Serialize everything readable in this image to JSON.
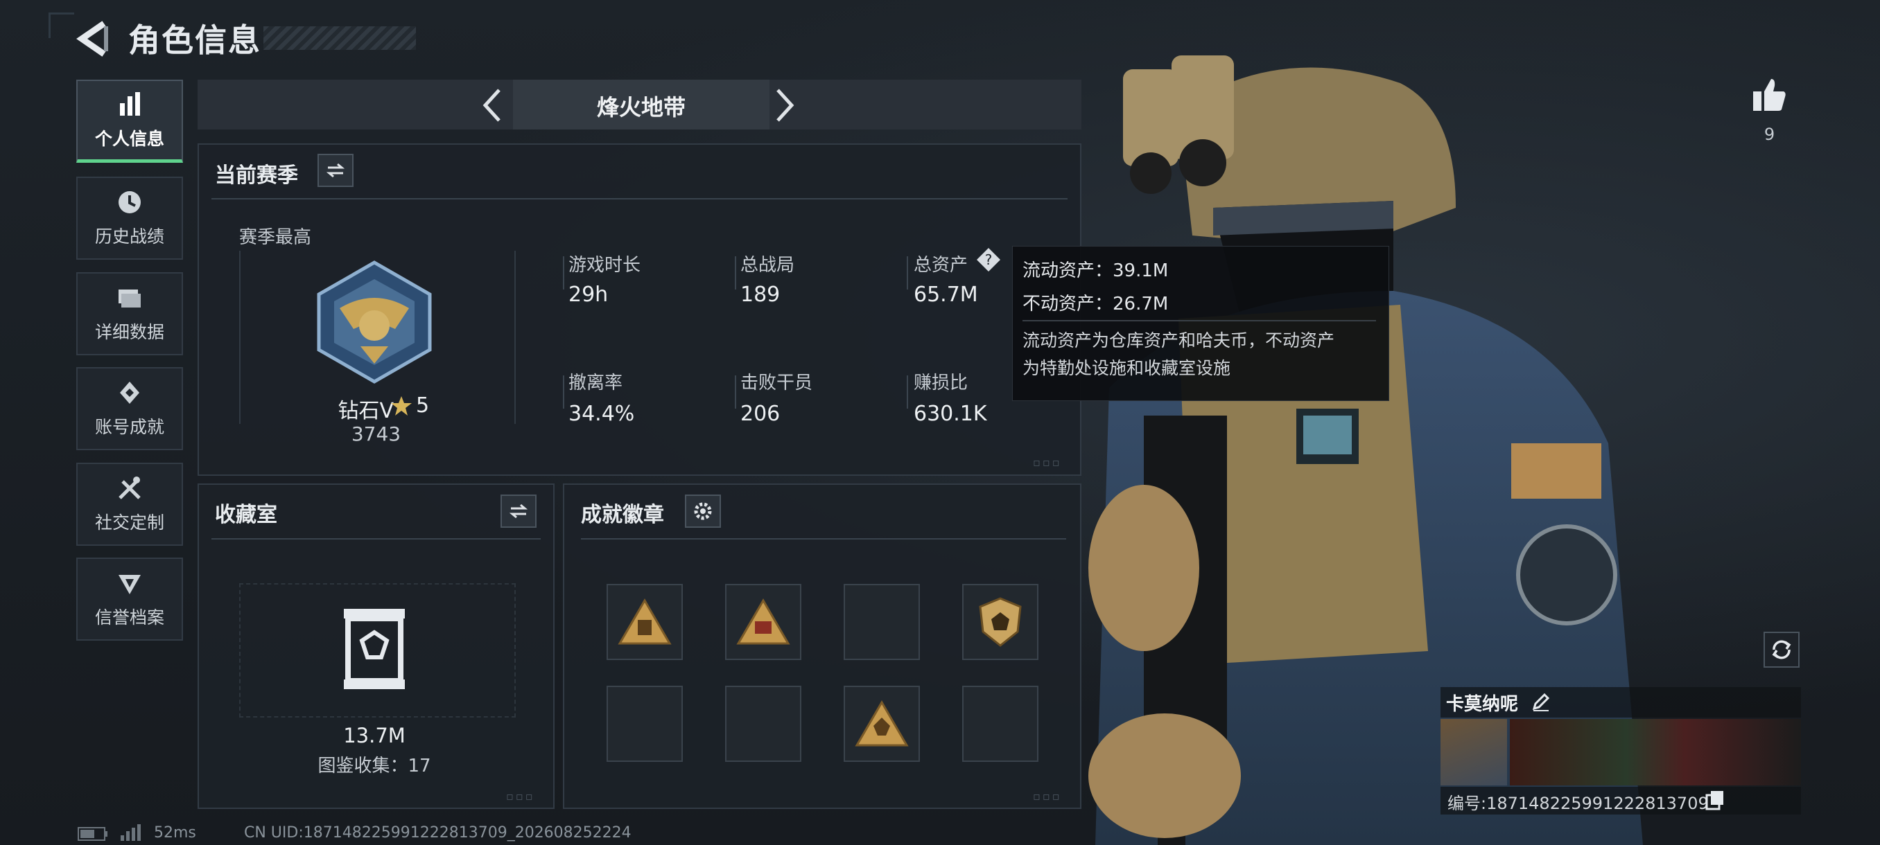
{
  "header": {
    "title": "角色信息"
  },
  "nav": {
    "items": [
      {
        "label": "个人信息",
        "icon": "bar-chart-icon",
        "active": true
      },
      {
        "label": "历史战绩",
        "icon": "clock-icon",
        "active": false
      },
      {
        "label": "详细数据",
        "icon": "folder-icon",
        "active": false
      },
      {
        "label": "账号成就",
        "icon": "achievement-icon",
        "active": false
      },
      {
        "label": "社交定制",
        "icon": "tools-icon",
        "active": false
      },
      {
        "label": "信誉档案",
        "icon": "reputation-icon",
        "active": false
      }
    ]
  },
  "mode": {
    "label": "烽火地带"
  },
  "season": {
    "title": "当前赛季",
    "highest_label": "赛季最高",
    "rank_name": "钻石V",
    "rank_stars": "5",
    "rank_score": "3743",
    "stats": [
      {
        "label": "游戏时长",
        "value": "29h"
      },
      {
        "label": "总战局",
        "value": "189"
      },
      {
        "label": "总资产",
        "value": "65.7M"
      },
      {
        "label": "撤离率",
        "value": "34.4%"
      },
      {
        "label": "击败干员",
        "value": "206"
      },
      {
        "label": "赚损比",
        "value": "630.1K"
      }
    ]
  },
  "tooltip": {
    "liquid": "流动资产：39.1M",
    "fixed": "不动资产：26.7M",
    "desc_line1": "流动资产为仓库资产和哈夫币，不动资产",
    "desc_line2": "为特勤处设施和收藏室设施"
  },
  "collection": {
    "title": "收藏室",
    "value": "13.7M",
    "catalog": "图鉴收集：17"
  },
  "badges": {
    "title": "成就徽章"
  },
  "likes": {
    "count": "9"
  },
  "player": {
    "name": "卡莫纳呢",
    "id": "编号:18714822599122281​3709"
  },
  "status": {
    "ping": "52ms",
    "uid": "CN UID:18714822599122281​3709_202608252224"
  },
  "colors": {
    "accent_green": "#5fd38d",
    "gold": "#c9a557",
    "panel_bg": "#1c2228"
  }
}
